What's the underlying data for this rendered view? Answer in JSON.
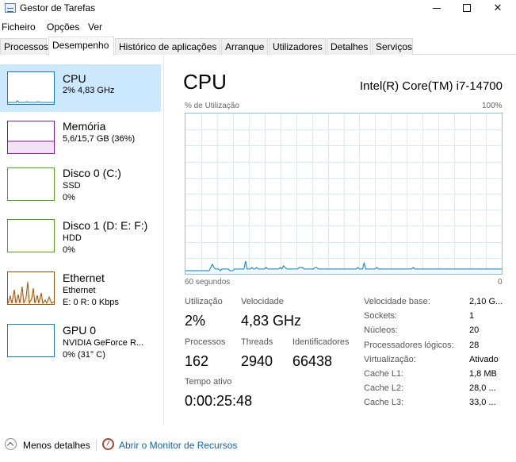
{
  "window": {
    "title": "Gestor de Tarefas"
  },
  "menu": [
    "Ficheiro",
    "Opções",
    "Ver"
  ],
  "tabs": [
    "Processos",
    "Desempenho",
    "Histórico de aplicações",
    "Arranque",
    "Utilizadores",
    "Detalhes",
    "Serviços"
  ],
  "resources": [
    {
      "name": "CPU",
      "sub1": "2% 4,83 GHz",
      "sub2": "",
      "color": "#117dbb"
    },
    {
      "name": "Memória",
      "sub1": "5,6/15,7 GB (36%)",
      "sub2": "",
      "color": "#8b12ae"
    },
    {
      "name": "Disco 0 (C:)",
      "sub1": "SSD",
      "sub2": "0%",
      "color": "#4da60c"
    },
    {
      "name": "Disco 1 (D: E: F:)",
      "sub1": "HDD",
      "sub2": "0%",
      "color": "#4da60c"
    },
    {
      "name": "Ethernet",
      "sub1": "Ethernet",
      "sub2": "E: 0 R: 0 Kbps",
      "color": "#a74f01"
    },
    {
      "name": "GPU 0",
      "sub1": "NVIDIA GeForce R...",
      "sub2": "0% (31° C)",
      "color": "#117dbb"
    }
  ],
  "main": {
    "title": "CPU",
    "model": "Intel(R) Core(TM) i7-14700",
    "graph": {
      "ylabel": "% de Utilização",
      "ymax_label": "100%",
      "xlabel": "60 segundos",
      "xmin_label": "0",
      "line_color": "#117dbb",
      "utilization_samples": [
        2,
        2,
        2,
        2,
        2,
        2,
        2,
        2,
        2,
        2,
        2,
        2,
        2,
        2,
        2,
        2,
        4,
        6,
        4,
        3,
        3,
        3,
        2,
        3,
        3,
        3,
        3,
        3,
        2,
        2,
        2,
        3,
        3,
        3,
        3,
        3,
        3,
        3,
        8,
        3,
        3,
        3,
        4,
        3,
        3,
        4,
        3,
        3,
        3,
        3,
        3,
        4,
        3,
        3,
        3,
        3,
        3,
        3,
        3,
        3,
        4,
        3,
        5,
        4,
        3,
        3,
        3,
        3,
        3,
        3,
        3,
        3,
        4,
        4,
        4,
        3,
        3,
        3,
        3,
        3,
        3,
        3,
        4,
        4,
        3,
        3,
        3,
        3,
        3,
        3,
        3,
        3,
        3,
        3,
        3,
        3,
        3,
        3,
        3,
        3,
        3,
        3,
        3,
        3,
        3,
        3,
        3,
        3,
        3,
        4,
        3,
        3,
        3,
        7,
        3,
        3,
        3,
        3,
        3,
        3,
        3,
        4,
        3,
        3,
        3,
        3,
        3,
        3,
        3,
        3,
        3,
        3,
        3,
        3,
        3,
        3,
        3,
        3,
        3,
        3,
        3,
        3,
        3,
        3,
        4,
        3,
        3,
        3,
        3,
        3,
        3,
        3,
        3,
        3,
        3,
        3,
        3,
        3,
        3,
        3,
        3,
        3,
        3,
        3,
        3,
        3,
        3,
        3,
        3,
        3,
        3,
        3,
        3,
        3,
        3,
        3,
        3,
        3,
        3,
        3,
        3,
        3,
        3,
        3,
        3,
        3,
        3,
        3,
        3,
        3,
        3,
        3,
        3,
        3,
        3,
        3,
        3,
        3,
        3,
        3,
        3
      ]
    },
    "stats": {
      "utilization": {
        "label": "Utilização",
        "value": "2%"
      },
      "speed": {
        "label": "Velocidade",
        "value": "4,83 GHz"
      },
      "processes": {
        "label": "Processos",
        "value": "162"
      },
      "threads": {
        "label": "Threads",
        "value": "2940"
      },
      "handles": {
        "label": "Identificadores",
        "value": "66438"
      },
      "uptime": {
        "label": "Tempo ativo",
        "value": "0:00:25:48"
      }
    },
    "specs": [
      {
        "label": "Velocidade base:",
        "value": "2,10 G..."
      },
      {
        "label": "Sockets:",
        "value": "1"
      },
      {
        "label": "Núcleos:",
        "value": "20"
      },
      {
        "label": "Processadores lógicos:",
        "value": "28"
      },
      {
        "label": "Virtualização:",
        "value": "Ativado"
      },
      {
        "label": "Cache L1:",
        "value": "1,8 MB"
      },
      {
        "label": "Cache L2:",
        "value": "28,0 ..."
      },
      {
        "label": "Cache L3:",
        "value": "33,0 ..."
      }
    ]
  },
  "footer": {
    "less_details": "Menos detalhes",
    "resource_monitor": "Abrir o Monitor de Recursos"
  }
}
